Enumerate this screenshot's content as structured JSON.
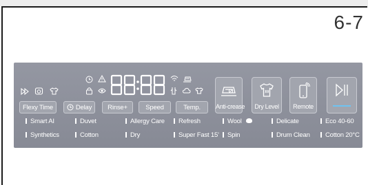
{
  "page_number": "6-7",
  "display": {
    "time": "88:88"
  },
  "buttons": {
    "flexy_time": "Flexy Time",
    "delay": "Delay",
    "rinse": "Rinse+",
    "speed": "Speed",
    "temp": "Temp.",
    "anti_crease": "Anti-crease",
    "dry_level": "Dry Level",
    "remote": "Remote"
  },
  "programs": {
    "row1": [
      "Smart AI",
      "Duvet",
      "Allergy Care",
      "Refresh",
      "Wool",
      "Delicate",
      "Eco 40-60"
    ],
    "row2": [
      "Synthetics",
      "Cotton",
      "Dry",
      "Super Fast 15'",
      "Spin",
      "Drum Clean",
      "Cotton 20°C"
    ]
  },
  "colors": {
    "panel": "#8e919c",
    "text": "#ffffff",
    "active_line": "#6ec3f2"
  }
}
